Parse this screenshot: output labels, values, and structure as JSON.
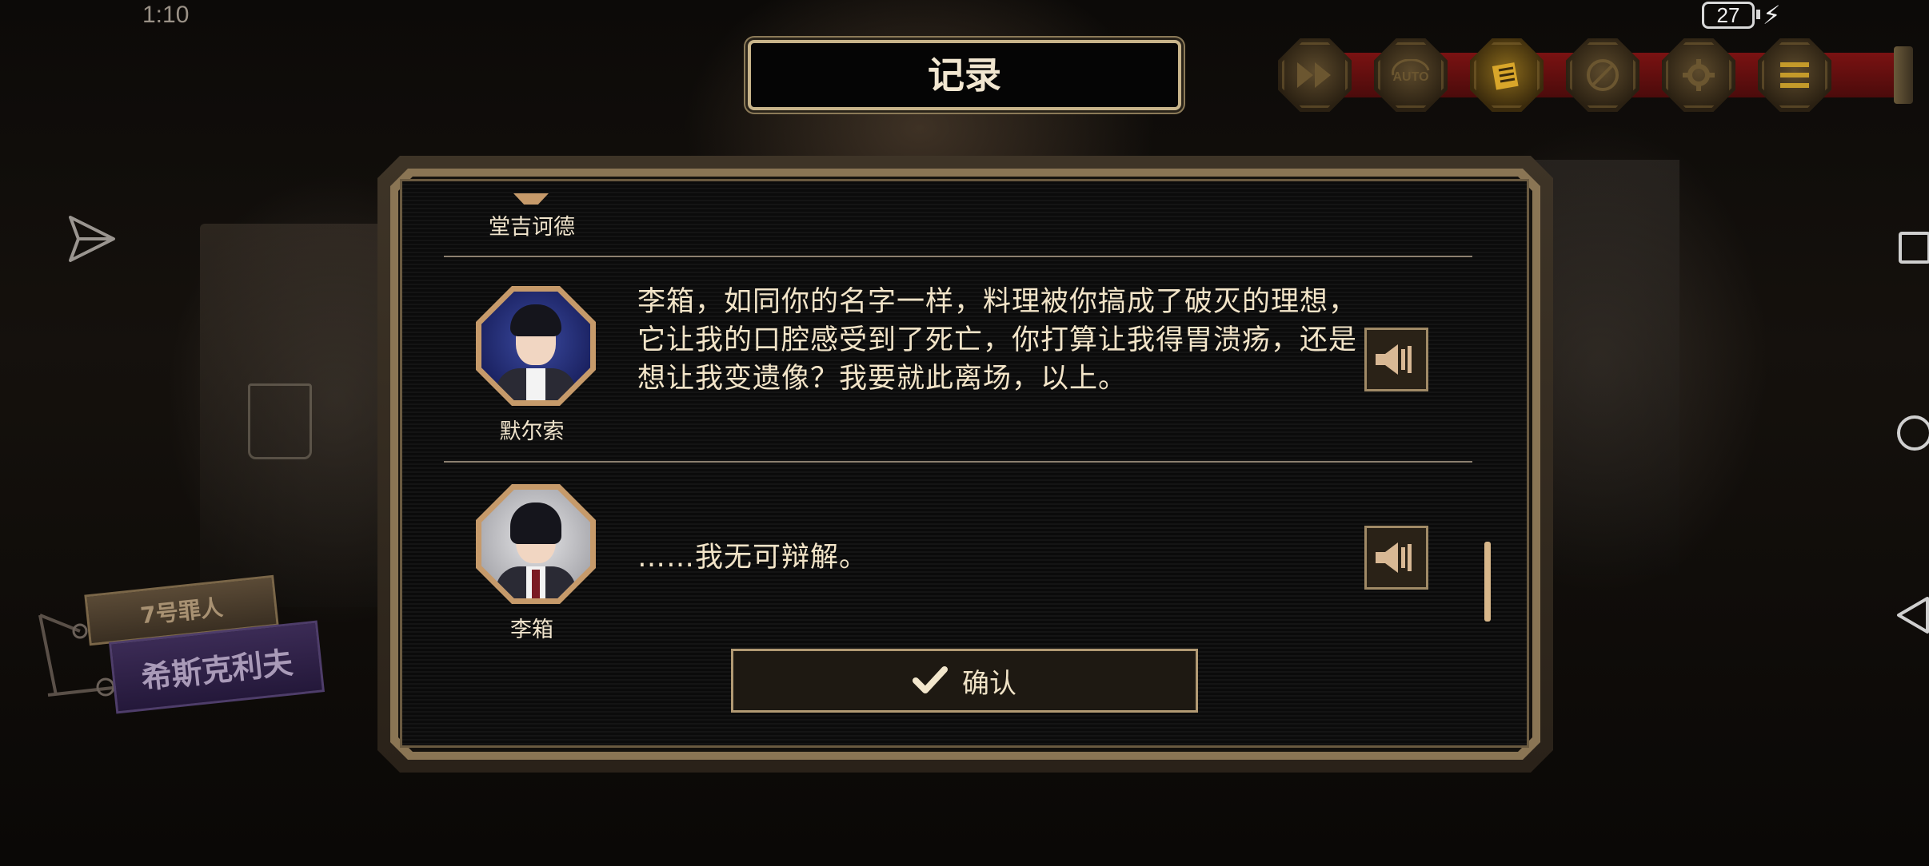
{
  "status_bar": {
    "time": "1:10",
    "battery": "27"
  },
  "dialog": {
    "title": "记录",
    "entries": [
      {
        "speaker": "堂吉诃德",
        "text": ""
      },
      {
        "speaker": "默尔索",
        "text": "李箱，如同你的名字一样，料理被你搞成了破灭的理想，它让我的口腔感受到了死亡，你打算让我得胃溃疡，还是想让我变遗像？我要就此离场，以上。"
      },
      {
        "speaker": "李箱",
        "text": "……我无可辩解。"
      }
    ],
    "confirm_label": "确认"
  },
  "character_tag": {
    "number": "7号罪人",
    "name": "希斯克利夫"
  },
  "toolbar": {
    "icons": [
      "fast-forward-icon",
      "auto-icon",
      "log-icon",
      "skip-disabled-icon",
      "settings-icon",
      "menu-icon"
    ],
    "active": "log-icon"
  },
  "colors": {
    "accent_gold": "#c8b48a",
    "panel_bg": "#0b0b0b",
    "toolbar_red": "#7a1212",
    "tag_purple": "#3b2b55"
  }
}
